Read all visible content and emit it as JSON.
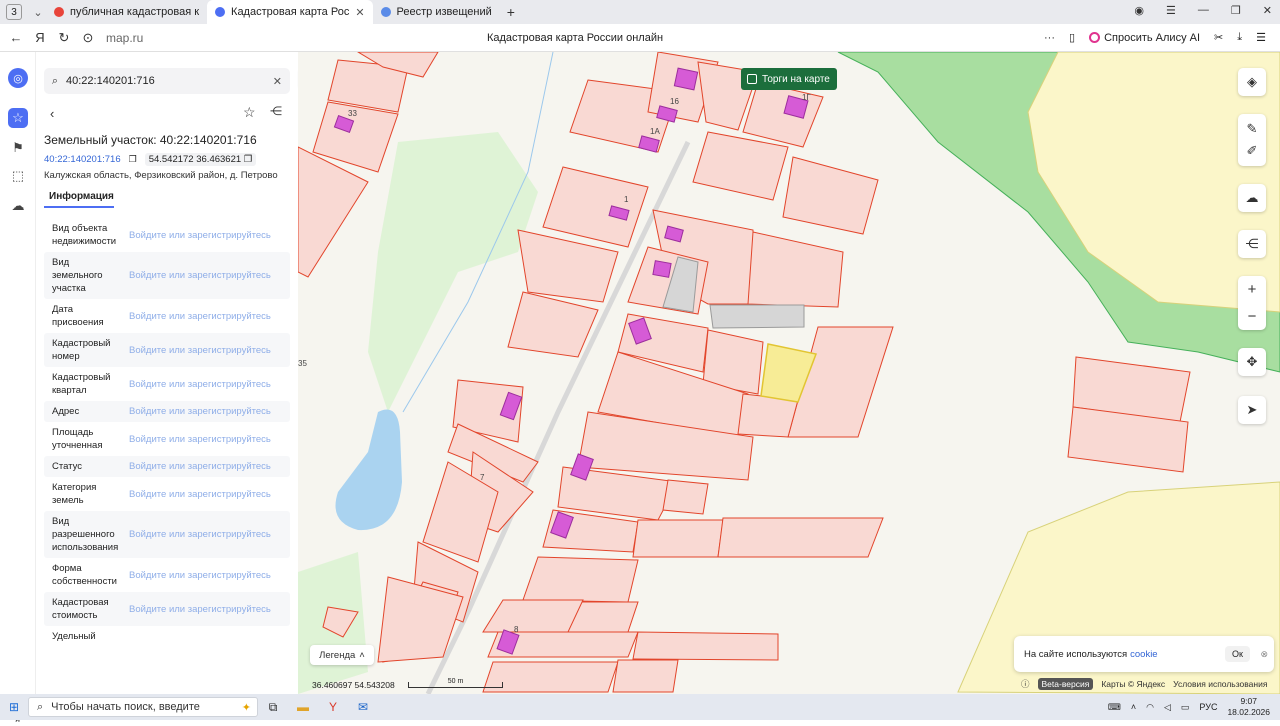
{
  "browser": {
    "tab_count": "3",
    "tabs": [
      {
        "label": "публичная кадастровая к",
        "active": false
      },
      {
        "label": "Кадастровая карта Рос",
        "active": true
      },
      {
        "label": "Реестр извещений",
        "active": false
      }
    ],
    "url": "map.ru",
    "page_title": "Кадастровая карта России онлайн",
    "alice_label": "Спросить Алису AI"
  },
  "panel": {
    "search_value": "40:22:140201:716",
    "title": "Земельный участок: 40:22:140201:716",
    "cadastral_number": "40:22:140201:716",
    "coords": "54.542172 36.463621",
    "address": "Калужская область, Ферзиковский район, д. Петрово",
    "info_tab": "Информация",
    "rows": [
      {
        "label": "Вид объекта недвижимости",
        "value": "Войдите или зарегистрируйтесь"
      },
      {
        "label": "Вид земельного участка",
        "value": "Войдите или зарегистрируйтесь"
      },
      {
        "label": "Дата присвоения",
        "value": "Войдите или зарегистрируйтесь"
      },
      {
        "label": "Кадастровый номер",
        "value": "Войдите или зарегистрируйтесь"
      },
      {
        "label": "Кадастровый квартал",
        "value": "Войдите или зарегистрируйтесь"
      },
      {
        "label": "Адрес",
        "value": "Войдите или зарегистрируйтесь"
      },
      {
        "label": "Площадь уточненная",
        "value": "Войдите или зарегистрируйтесь"
      },
      {
        "label": "Статус",
        "value": "Войдите или зарегистрируйтесь"
      },
      {
        "label": "Категория земель",
        "value": "Войдите или зарегистрируйтесь"
      },
      {
        "label": "Вид разрешенного использования",
        "value": "Войдите или зарегистрируйтесь"
      },
      {
        "label": "Форма собственности",
        "value": "Войдите или зарегистрируйтесь"
      },
      {
        "label": "Кадастровая стоимость",
        "value": "Войдите или зарегистрируйтесь"
      },
      {
        "label": "Удельный",
        "value": ""
      }
    ]
  },
  "map": {
    "torgi_label": "Торги на карте",
    "legend_label": "Легенда",
    "cursor_coords": "36.460697  54.543208",
    "scale_label": "50 m",
    "cookie_text": "На сайте используются",
    "cookie_link": "cookie",
    "cookie_ok": "Ок",
    "beta_label": "Beta-версия",
    "attribution": "Карты © Яндекс",
    "terms": "Условия использования",
    "parcel_labels": [
      "33",
      "16",
      "1А",
      "1Г",
      "1",
      "7",
      "8",
      "35"
    ]
  },
  "taskbar": {
    "search_placeholder": "Чтобы начать поиск, введите",
    "lang": "РУС",
    "time": "9:07",
    "date": "18.02.2026"
  },
  "colors": {
    "accent": "#4d6ef3",
    "parcel_fill": "#f9d9d3",
    "parcel_stroke": "#e2452b",
    "building": "#d65bd6",
    "selected": "#f7ec96",
    "forest": "#8fd98a",
    "water": "#aad3f0",
    "torgi": "#1c6e3c"
  }
}
